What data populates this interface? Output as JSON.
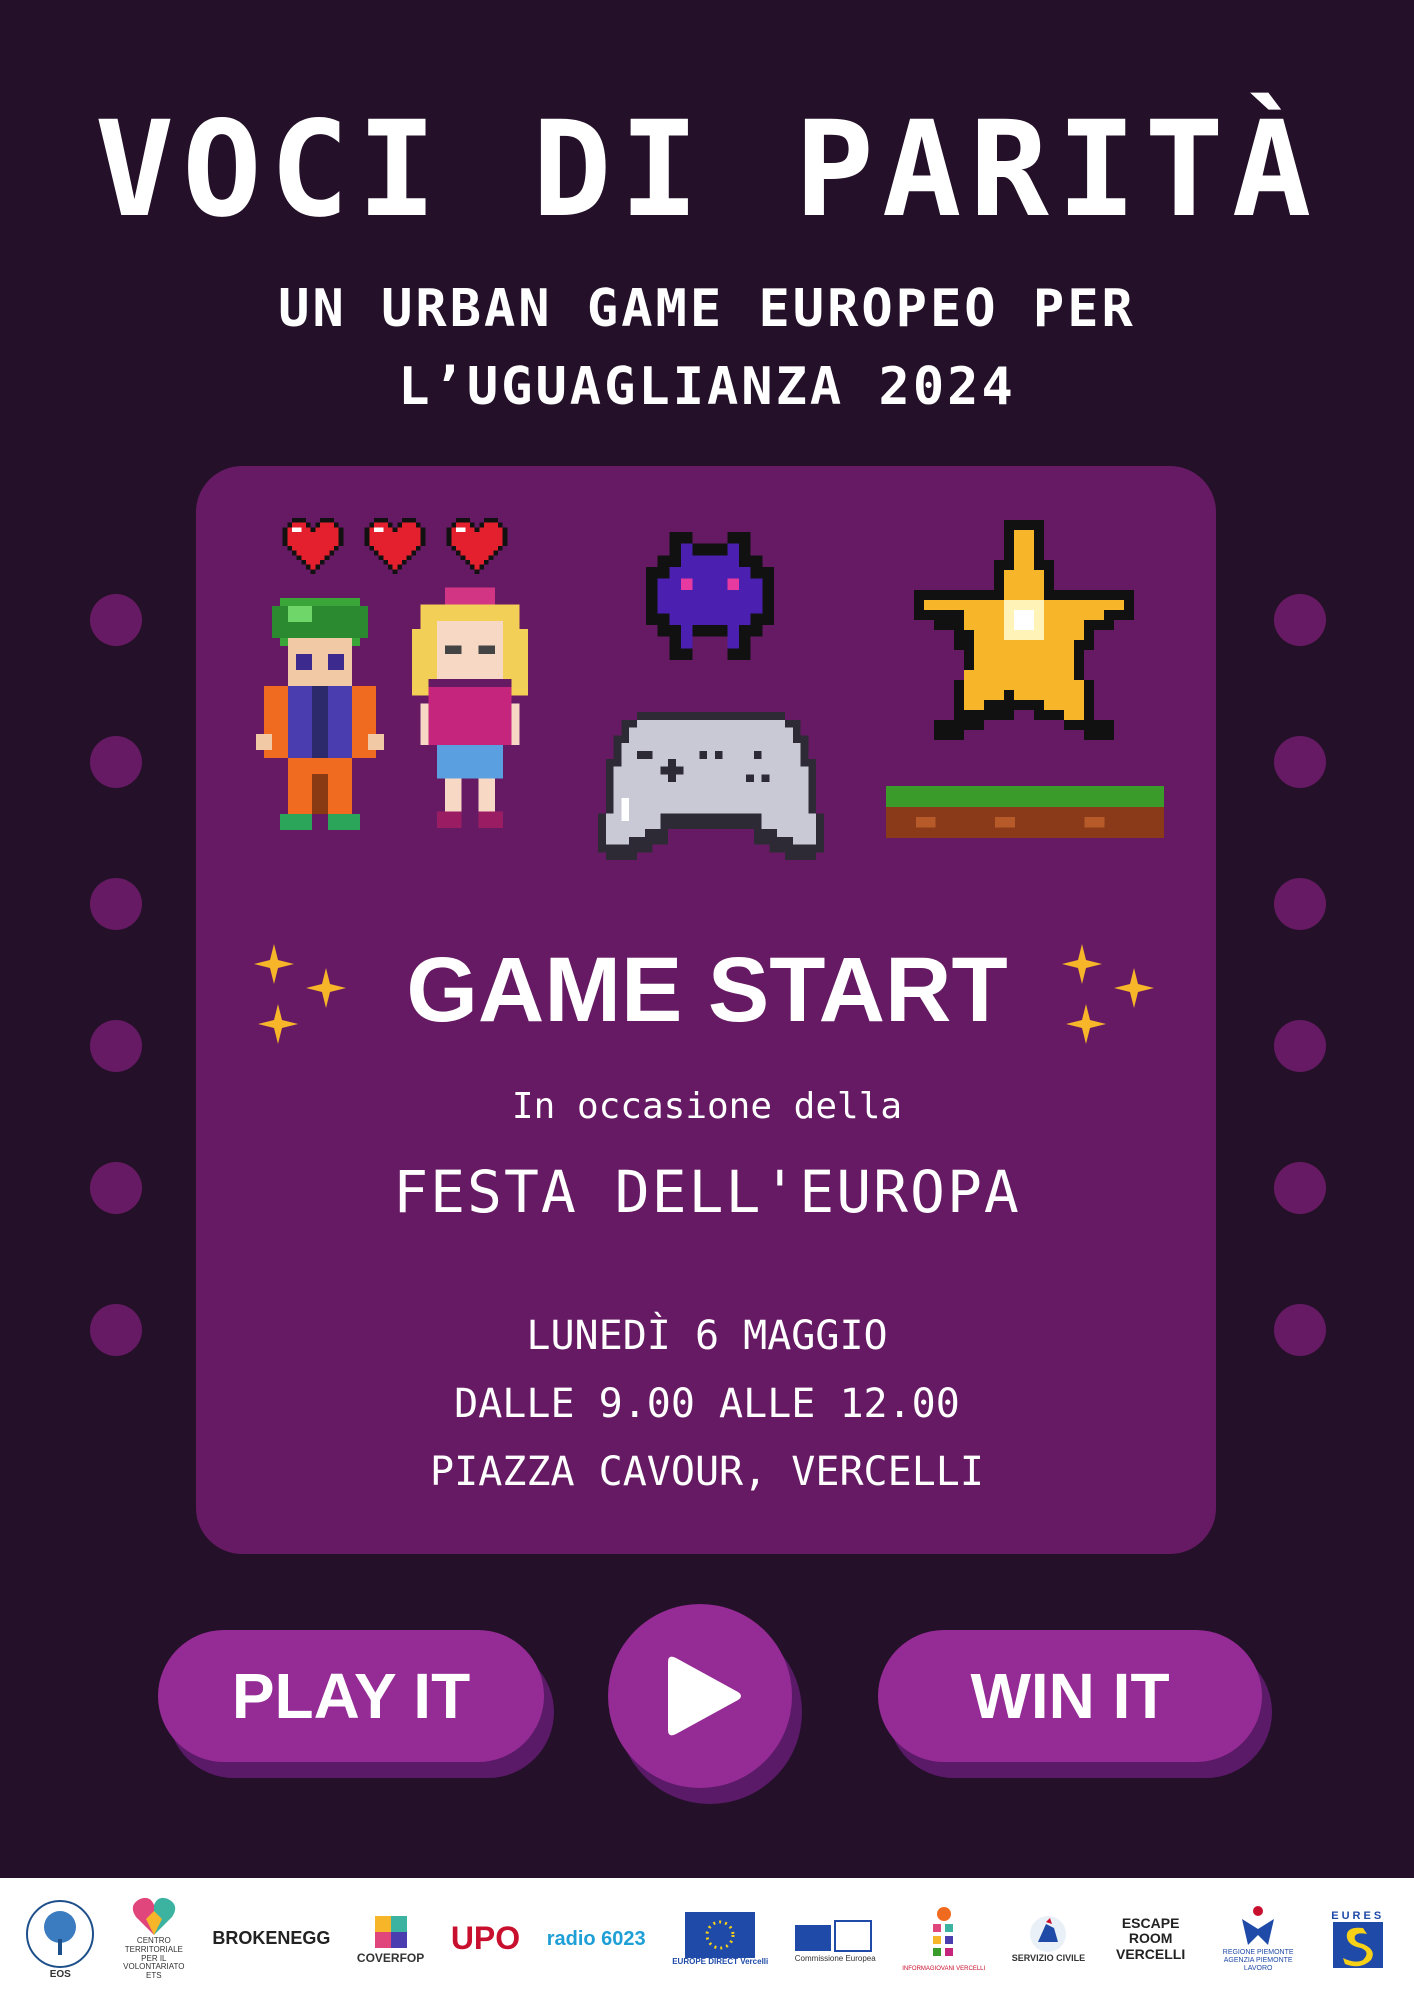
{
  "header": {
    "title": "VOCI DI PARITÀ",
    "subtitle_line1": "UN URBAN GAME EUROPEO PER",
    "subtitle_line2": "L’UGUAGLIANZA 2024"
  },
  "panel": {
    "headline": "GAME START",
    "occasion": "In occasione della",
    "event": "FESTA DELL'EUROPA",
    "date": "LUNEDÌ 6 MAGGIO",
    "time": "DALLE 9.00 ALLE 12.00",
    "place": "PIAZZA CAVOUR, VERCELLI"
  },
  "actions": {
    "play_label": "PLAY IT",
    "win_label": "WIN IT",
    "play_icon": "play-triangle-icon"
  },
  "decor": {
    "hearts": 3,
    "heart_icon": "pixel-heart-icon",
    "sprites": [
      "pixel-boy",
      "pixel-girl",
      "space-invader",
      "gamepad",
      "pixel-star",
      "grass-platform"
    ]
  },
  "colors": {
    "background": "#241028",
    "panel": "#661a63",
    "button": "#952b95",
    "button_shadow": "#5a1a68",
    "sparkle": "#f7b52a"
  },
  "footer": {
    "logos": [
      {
        "name": "EOS",
        "text": "EOS"
      },
      {
        "name": "CSV",
        "text": "CENTRO TERRITORIALE PER IL VOLONTARIATO ETS"
      },
      {
        "name": "BrokenEgg",
        "text": "BROKENEGG"
      },
      {
        "name": "Coverfop",
        "text": "COVERFOP"
      },
      {
        "name": "UPO",
        "text": "UPO"
      },
      {
        "name": "Radio 6023",
        "text": "radio 6023"
      },
      {
        "name": "Europe Direct",
        "text": "EUROPE DIRECT Vercelli"
      },
      {
        "name": "Commissione Europea",
        "text": "Commissione Europea"
      },
      {
        "name": "Informagiovani",
        "text": "INFORMAGIOVANI VERCELLI"
      },
      {
        "name": "Servizio Civile",
        "text": "SERVIZIO CIVILE"
      },
      {
        "name": "Escape Room",
        "text": "ESCAPE ROOM VERCELLI"
      },
      {
        "name": "Regione Piemonte",
        "text": "REGIONE PIEMONTE AGENZIA PIEMONTE LAVORO"
      },
      {
        "name": "EURES",
        "text": "EURES"
      }
    ]
  }
}
